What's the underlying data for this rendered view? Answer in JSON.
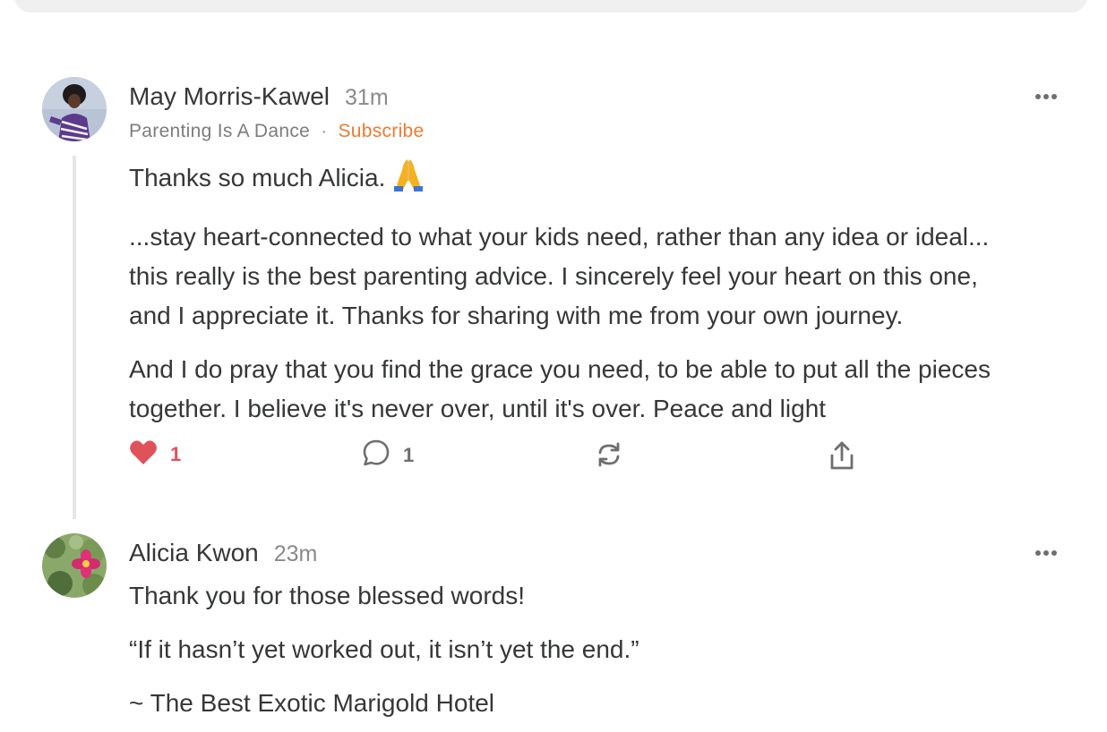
{
  "comments": [
    {
      "author": "May Morris-Kawel",
      "time": "31m",
      "publication": "Parenting Is A Dance",
      "separator": "·",
      "subscribe_label": "Subscribe",
      "paragraphs": [
        "Thanks so much Alicia.",
        "...stay heart-connected to what your kids need, rather than any idea or ideal...",
        "this really is the best parenting advice. I sincerely feel your heart on this one,",
        "and I appreciate it. Thanks for sharing with me from your own journey.",
        "And I do pray that you find the grace you need, to be able to put all the pieces",
        "together. I believe it's never over, until it's over. Peace and light"
      ],
      "emoji_icon": "praying-hands-emoji",
      "likes": "1",
      "replies": "1"
    },
    {
      "author": "Alicia Kwon",
      "time": "23m",
      "paragraphs": [
        "Thank you for those blessed words!",
        "“If it hasn’t yet worked out, it isn’t yet the end.”",
        "~ The Best Exotic Marigold Hotel"
      ]
    }
  ],
  "icons": {
    "heart": "heart-icon",
    "reply": "comment-bubble-icon",
    "restack": "restack-icon",
    "share": "share-icon",
    "more": "more-options-icon"
  },
  "colors": {
    "accent": "#ef7a2f",
    "heart": "#e0525a"
  }
}
